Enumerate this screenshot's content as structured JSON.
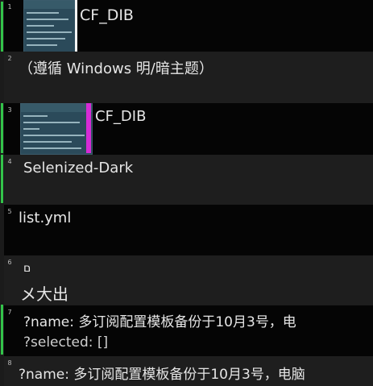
{
  "rows": [
    {
      "index": "1",
      "text": "CF_DIB"
    },
    {
      "index": "2",
      "text": "（遵循 Windows 明/暗主题）"
    },
    {
      "index": "3",
      "text": "CF_DIB"
    },
    {
      "index": "4",
      "text": "Selenized-Dark"
    },
    {
      "index": "5",
      "text": "list.yml"
    },
    {
      "index": "6",
      "line1": "ם",
      "line2": "メ大出"
    },
    {
      "index": "7",
      "line1": "?name: 多订阅配置模板备份于10月3号，电",
      "line2": "?selected: []"
    },
    {
      "index": "8",
      "text": "?name: 多订阅配置模板备份于10月3号，电脑"
    }
  ],
  "colors": {
    "gutter_accent": "#33c44a",
    "thumbnail_marker": "#d62bd6"
  }
}
